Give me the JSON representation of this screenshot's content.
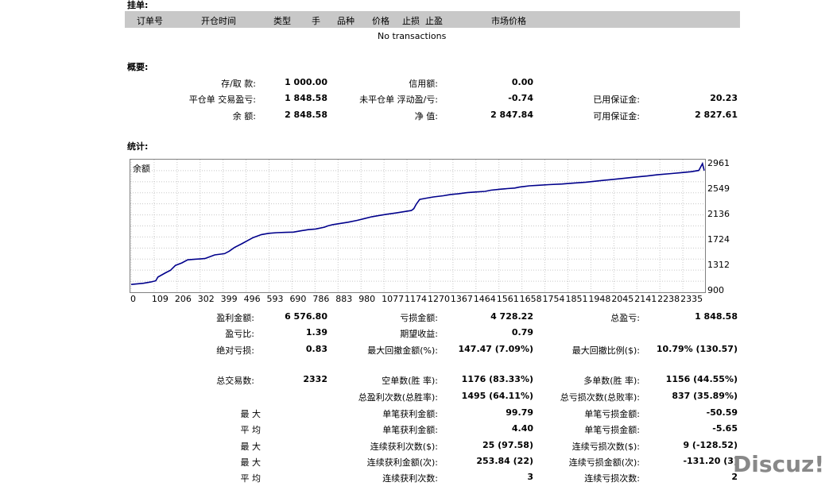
{
  "sections": {
    "orders": "挂单:",
    "summary": "概要:",
    "stats": "统计:"
  },
  "orders_header": [
    "订单号",
    "开仓时间",
    "类型",
    "手",
    "品种",
    "价格",
    "止损",
    "止盈",
    "市场价格"
  ],
  "orders_empty": "No transactions",
  "summary": {
    "deposit_label": "存/取 款:",
    "deposit_value": "1 000.00",
    "credit_label": "信用额:",
    "credit_value": "0.00",
    "closed_pl_label": "平仓单 交易盈亏:",
    "closed_pl_value": "1 848.58",
    "floating_pl_label": "未平仓单 浮动盈/亏:",
    "floating_pl_value": "-0.74",
    "margin_used_label": "已用保证金:",
    "margin_used_value": "20.23",
    "balance_label": "余 额:",
    "balance_value": "2 848.58",
    "equity_label": "净 值:",
    "equity_value": "2 847.84",
    "free_margin_label": "可用保证金:",
    "free_margin_value": "2 827.61"
  },
  "chart_data": {
    "type": "line",
    "title": "余额",
    "series": [
      {
        "name": "余额",
        "color": "#00008b"
      }
    ],
    "x_ticks": [
      "0",
      "109",
      "206",
      "302",
      "399",
      "496",
      "593",
      "690",
      "786",
      "883",
      "980",
      "1077",
      "1174",
      "1270",
      "1367",
      "1464",
      "1561",
      "1658",
      "1754",
      "1851",
      "1948",
      "2045",
      "2141",
      "2238",
      "2335"
    ],
    "y_ticks": [
      "2961",
      "2549",
      "2136",
      "1724",
      "1312",
      "900"
    ],
    "ylim": [
      900,
      3000
    ],
    "xlim": [
      0,
      2332
    ],
    "grid": true,
    "x": [
      0,
      50,
      80,
      100,
      109,
      140,
      160,
      180,
      206,
      230,
      260,
      300,
      340,
      380,
      399,
      420,
      450,
      496,
      530,
      560,
      593,
      630,
      660,
      690,
      720,
      750,
      786,
      800,
      820,
      850,
      883,
      920,
      950,
      980,
      1010,
      1040,
      1077,
      1110,
      1140,
      1150,
      1160,
      1174,
      1200,
      1230,
      1270,
      1300,
      1330,
      1367,
      1400,
      1440,
      1464,
      1500,
      1530,
      1561,
      1580,
      1600,
      1620,
      1658,
      1700,
      1754,
      1800,
      1851,
      1900,
      1948,
      2000,
      2045,
      2100,
      2141,
      2200,
      2238,
      2280,
      2310,
      2325,
      2332
    ],
    "y": [
      1000,
      1020,
      1040,
      1060,
      1120,
      1190,
      1230,
      1310,
      1350,
      1400,
      1410,
      1420,
      1480,
      1500,
      1540,
      1600,
      1660,
      1760,
      1810,
      1830,
      1840,
      1845,
      1850,
      1870,
      1890,
      1900,
      1930,
      1950,
      1970,
      1990,
      2010,
      2040,
      2070,
      2100,
      2120,
      2140,
      2160,
      2180,
      2200,
      2230,
      2300,
      2380,
      2400,
      2420,
      2440,
      2460,
      2470,
      2490,
      2500,
      2510,
      2530,
      2545,
      2555,
      2565,
      2580,
      2590,
      2600,
      2610,
      2620,
      2630,
      2645,
      2660,
      2680,
      2700,
      2720,
      2740,
      2760,
      2780,
      2800,
      2815,
      2830,
      2850,
      2961,
      2848
    ]
  },
  "stats": {
    "gross_profit_label": "盈利金额:",
    "gross_profit_value": "6 576.80",
    "gross_loss_label": "亏损金额:",
    "gross_loss_value": "4 728.22",
    "total_net_label": "总盈亏:",
    "total_net_value": "1 848.58",
    "profit_factor_label": "盈亏比:",
    "profit_factor_value": "1.39",
    "expected_payoff_label": "期望收益:",
    "expected_payoff_value": "0.79",
    "abs_dd_label": "绝对亏损:",
    "abs_dd_value": "0.83",
    "max_dd_label": "最大回撤金额(%):",
    "max_dd_value": "147.47 (7.09%)",
    "rel_dd_label": "最大回撤比例($):",
    "rel_dd_value": "10.79% (130.57)",
    "total_trades_label": "总交易数:",
    "total_trades_value": "2332",
    "short_label": "空单数(胜 率):",
    "short_value": "1176 (83.33%)",
    "long_label": "多单数(胜 率):",
    "long_value": "1156 (44.55%)",
    "profit_trades_label": "总盈利次数(总胜率):",
    "profit_trades_value": "1495 (64.11%)",
    "loss_trades_label": "总亏损次数(总败率):",
    "loss_trades_value": "837 (35.89%)",
    "max1_label": "最 大",
    "largest_profit_label": "单笔获利金额:",
    "largest_profit_value": "99.79",
    "largest_loss_label": "单笔亏损金额:",
    "largest_loss_value": "-50.59",
    "avg1_label": "平 均",
    "avg_profit_label": "单笔获利金额:",
    "avg_profit_value": "4.40",
    "avg_loss_label": "单笔亏损金额:",
    "avg_loss_value": "-5.65",
    "max2_label": "最 大",
    "max_cons_wins_label": "连续获利次数($):",
    "max_cons_wins_value": "25 (97.58)",
    "max_cons_losses_label": "连续亏损次数($):",
    "max_cons_losses_value": "9 (-128.52)",
    "max3_label": "最 大",
    "max_cons_profit_label": "连续获利金额(次):",
    "max_cons_profit_value": "253.84 (22)",
    "max_cons_loss_label": "连续亏损金额(次):",
    "max_cons_loss_value": "-131.20 (3)",
    "avg2_label": "平 均",
    "avg_cons_wins_label": "连续获利次数:",
    "avg_cons_wins_value": "3",
    "avg_cons_losses_label": "连续亏损次数:",
    "avg_cons_losses_value": "2"
  },
  "watermark": "Discuz!"
}
